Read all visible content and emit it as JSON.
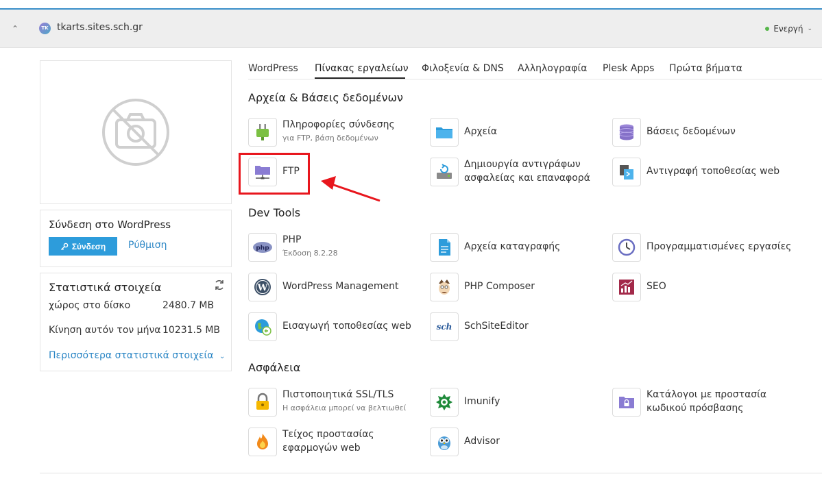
{
  "header": {
    "site_badge": "TK",
    "site_name": "tkarts.sites.sch.gr",
    "status": "Ενεργή",
    "status_color": "#56b64a"
  },
  "wordpress_login": {
    "title": "Σύνδεση στο WordPress",
    "login_button": "Σύνδεση",
    "setup_link": "Ρύθμιση"
  },
  "stats": {
    "title": "Στατιστικά στοιχεία",
    "disk_label": "χώρος στο δίσκο",
    "disk_value": "2480.7 MB",
    "traffic_label": "Κίνηση αυτόν τον μήνα",
    "traffic_value": "10231.5 MB",
    "more_link": "Περισσότερα στατιστικά στοιχεία"
  },
  "tabs": [
    {
      "label": "WordPress"
    },
    {
      "label": "Πίνακας εργαλείων",
      "active": true
    },
    {
      "label": "Φιλοξενία & DNS"
    },
    {
      "label": "Αλληλογραφία"
    },
    {
      "label": "Plesk Apps"
    },
    {
      "label": "Πρώτα βήματα"
    }
  ],
  "sections": {
    "files_db": {
      "title": "Αρχεία & Βάσεις δεδομένων",
      "tools": [
        {
          "label": "Πληροφορίες σύνδεσης",
          "sub": "για FTP, βάση δεδομένων",
          "icon": "plug-icon"
        },
        {
          "label": "Αρχεία",
          "icon": "folder-icon"
        },
        {
          "label": "Βάσεις δεδομένων",
          "icon": "database-icon"
        },
        {
          "label": "FTP",
          "icon": "ftp-folder-icon"
        },
        {
          "label": "Δημιουργία αντιγράφων",
          "label2": "ασφαλείας και επαναφορά",
          "icon": "backup-icon"
        },
        {
          "label": "Αντιγραφή τοποθεσίας web",
          "icon": "copy-site-icon"
        }
      ]
    },
    "dev_tools": {
      "title": "Dev Tools",
      "tools": [
        {
          "label": "PHP",
          "sub": "Έκδοση 8.2.28",
          "icon": "php-icon"
        },
        {
          "label": "Αρχεία καταγραφής",
          "icon": "log-file-icon"
        },
        {
          "label": "Προγραμματισμένες εργασίες",
          "icon": "clock-icon"
        },
        {
          "label": "WordPress Management",
          "icon": "wordpress-icon"
        },
        {
          "label": "PHP Composer",
          "icon": "composer-icon"
        },
        {
          "label": "SEO",
          "icon": "seo-chart-icon"
        },
        {
          "label": "Εισαγωγή τοποθεσίας web",
          "icon": "globe-import-icon"
        },
        {
          "label": "SchSiteEditor",
          "icon": "sch-logo-icon",
          "icon_text": "sch"
        }
      ]
    },
    "security": {
      "title": "Ασφάλεια",
      "tools": [
        {
          "label": "Πιστοποιητικά SSL/TLS",
          "sub": "Η ασφάλεια μπορεί να βελτιωθεί",
          "icon": "padlock-icon"
        },
        {
          "label": "Imunify",
          "icon": "imunify-icon"
        },
        {
          "label": "Κατάλογοι με προστασία",
          "label2": "κωδικού πρόσβασης",
          "icon": "protected-folder-icon"
        },
        {
          "label": "Τείχος προστασίας",
          "label2": "εφαρμογών web",
          "icon": "flame-icon"
        },
        {
          "label": "Advisor",
          "icon": "owl-icon"
        }
      ]
    }
  },
  "colors": {
    "accent": "#2d9cdb",
    "link": "#2b86c5",
    "highlight": "#e8161d"
  }
}
